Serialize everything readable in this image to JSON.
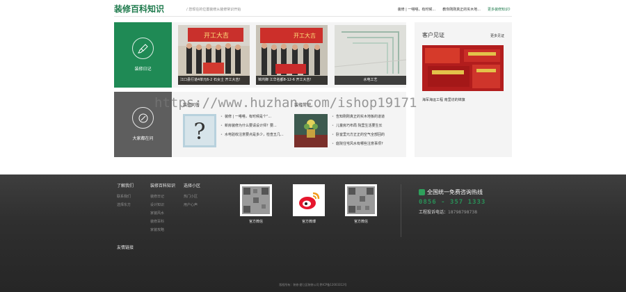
{
  "header": {
    "title": "装修百科知识",
    "slogan": "/ 您现在的位置装修从装修常识开始",
    "links": [
      "装修 | 一嗒嗒，有时候...",
      "教你刚刚真正的实木地...",
      "更多装修知识》"
    ]
  },
  "watermark": "https://www.huzhan.com/ishop19171",
  "categories": [
    {
      "label": "装修日记",
      "icon": "brush-icon"
    },
    {
      "label": "大家都在问",
      "icon": "compass-icon"
    }
  ],
  "diary_photos": [
    {
      "caption": "江口县行道4单元6-2 石女士 开工大吉!",
      "banner": "开工大吉"
    },
    {
      "caption": "锦鸿御 江华名都8-12-6 开工大吉!",
      "banner": "开工大吉"
    },
    {
      "caption": "水电工艺"
    }
  ],
  "news": [
    {
      "title": "装修问答",
      "thumb_icon": "question-mark-icon",
      "items": [
        "装修 | 一嗒嗒，有时候是个“...",
        "新房装修为什么要请设计师？要...",
        "水电验收注意要点是多少，检查五几..."
      ]
    },
    {
      "title": "装修常识",
      "thumb_icon": "flower-vase-icon",
      "items": [
        "告知刚刚真正的实木地板的道道",
        "儿童房巧布局 院里生活要生长",
        "卧室里元方正正的空气全部回的",
        "庭院住宅风水有哪些注意事项?"
      ]
    }
  ],
  "testimony": {
    "title": "客户见证",
    "more": "更多见证",
    "caption": "海军海运工程 南里坊的锦旗"
  },
  "footer": {
    "columns": [
      {
        "head": "了解我们",
        "links": [
          "联系我们",
          "选择东方"
        ]
      },
      {
        "head": "装修百科知识",
        "links": [
          "装修日记",
          "设计知识",
          "家装风水",
          "装修百科",
          "家装攻略"
        ]
      },
      {
        "head": "选择小区",
        "links": [
          "热门小区",
          "用户心声"
        ]
      }
    ],
    "friend_links": "友情链接",
    "qrcodes": [
      {
        "label": "官方微信"
      },
      {
        "label": "官方微博"
      },
      {
        "label": "官方微信"
      }
    ],
    "hotline_title": "全国统一免费咨询热线",
    "hotline_number": "0856 - 357 1333",
    "project_label": "工程投诉电话：",
    "project_number": "18798798738",
    "copyright": "版权所有：装修·碧江区装修公司 黔ICP备12003312号"
  },
  "colors": {
    "brand_green": "#1f8a55",
    "category_gray": "#5e5e5e",
    "footer_bg": "#2f2f2f"
  }
}
